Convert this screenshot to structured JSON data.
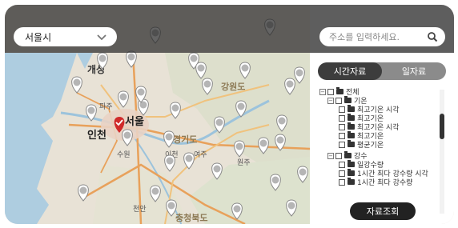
{
  "region_select": {
    "value": "서울시"
  },
  "search": {
    "placeholder": "주소를 입력하세요."
  },
  "tabs": [
    {
      "label": "시간자료",
      "active": true
    },
    {
      "label": "일자료",
      "active": false
    }
  ],
  "tree": {
    "root": "전체",
    "groups": [
      {
        "label": "기온",
        "items": [
          "최고기온 시각",
          "최고기온",
          "최고기온 시각",
          "최고기온",
          "평균기온"
        ]
      },
      {
        "label": "강수",
        "items": [
          "일강수량",
          "1시간 최다 강수량 시각",
          "1시간 최다 강수량"
        ]
      }
    ]
  },
  "map": {
    "place_labels": [
      "개성",
      "강원도",
      "파주",
      "인천",
      "서울",
      "수원",
      "이천",
      "경기도",
      "충청북도",
      "천안",
      "원주",
      "여주"
    ]
  },
  "query_button": {
    "label": "자료조회"
  },
  "colors": {
    "accent": "#222222",
    "marker_selected": "#d02a2a",
    "tab_active": "#3d3d3d"
  }
}
